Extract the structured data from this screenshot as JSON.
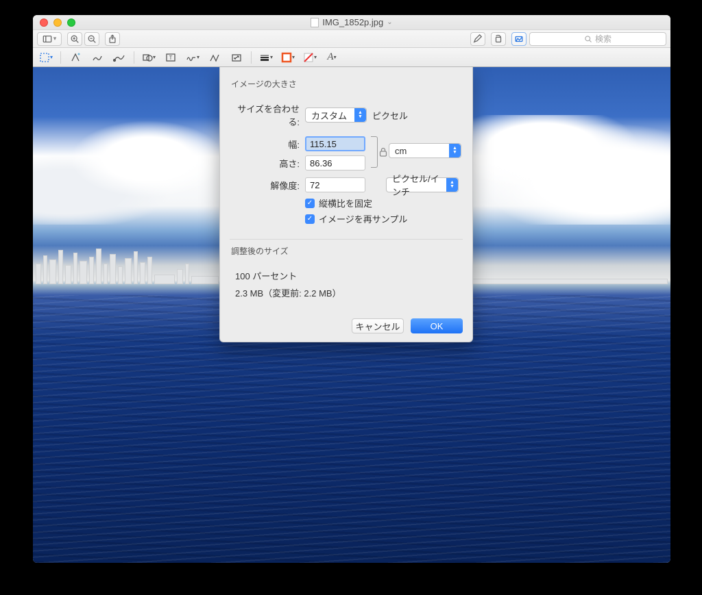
{
  "window": {
    "filename": "IMG_1852p.jpg"
  },
  "toolbar": {
    "search_placeholder": "検索",
    "highlight_tool_active": true
  },
  "dialog": {
    "title": "イメージの大きさ",
    "fit_label": "サイズを合わせる:",
    "fit_value": "カスタム",
    "fit_unit_label": "ピクセル",
    "width_label": "幅:",
    "width_value": "115.15",
    "height_label": "高さ:",
    "height_value": "86.36",
    "dim_unit": "cm",
    "resolution_label": "解像度:",
    "resolution_value": "72",
    "resolution_unit": "ピクセル/インチ",
    "lock_ratio_label": "縦横比を固定",
    "resample_label": "イメージを再サンプル",
    "result_title": "調整後のサイズ",
    "result_percent": "100 パーセント",
    "result_size": "2.3 MB（変更前: 2.2 MB）",
    "cancel": "キャンセル",
    "ok": "OK"
  }
}
